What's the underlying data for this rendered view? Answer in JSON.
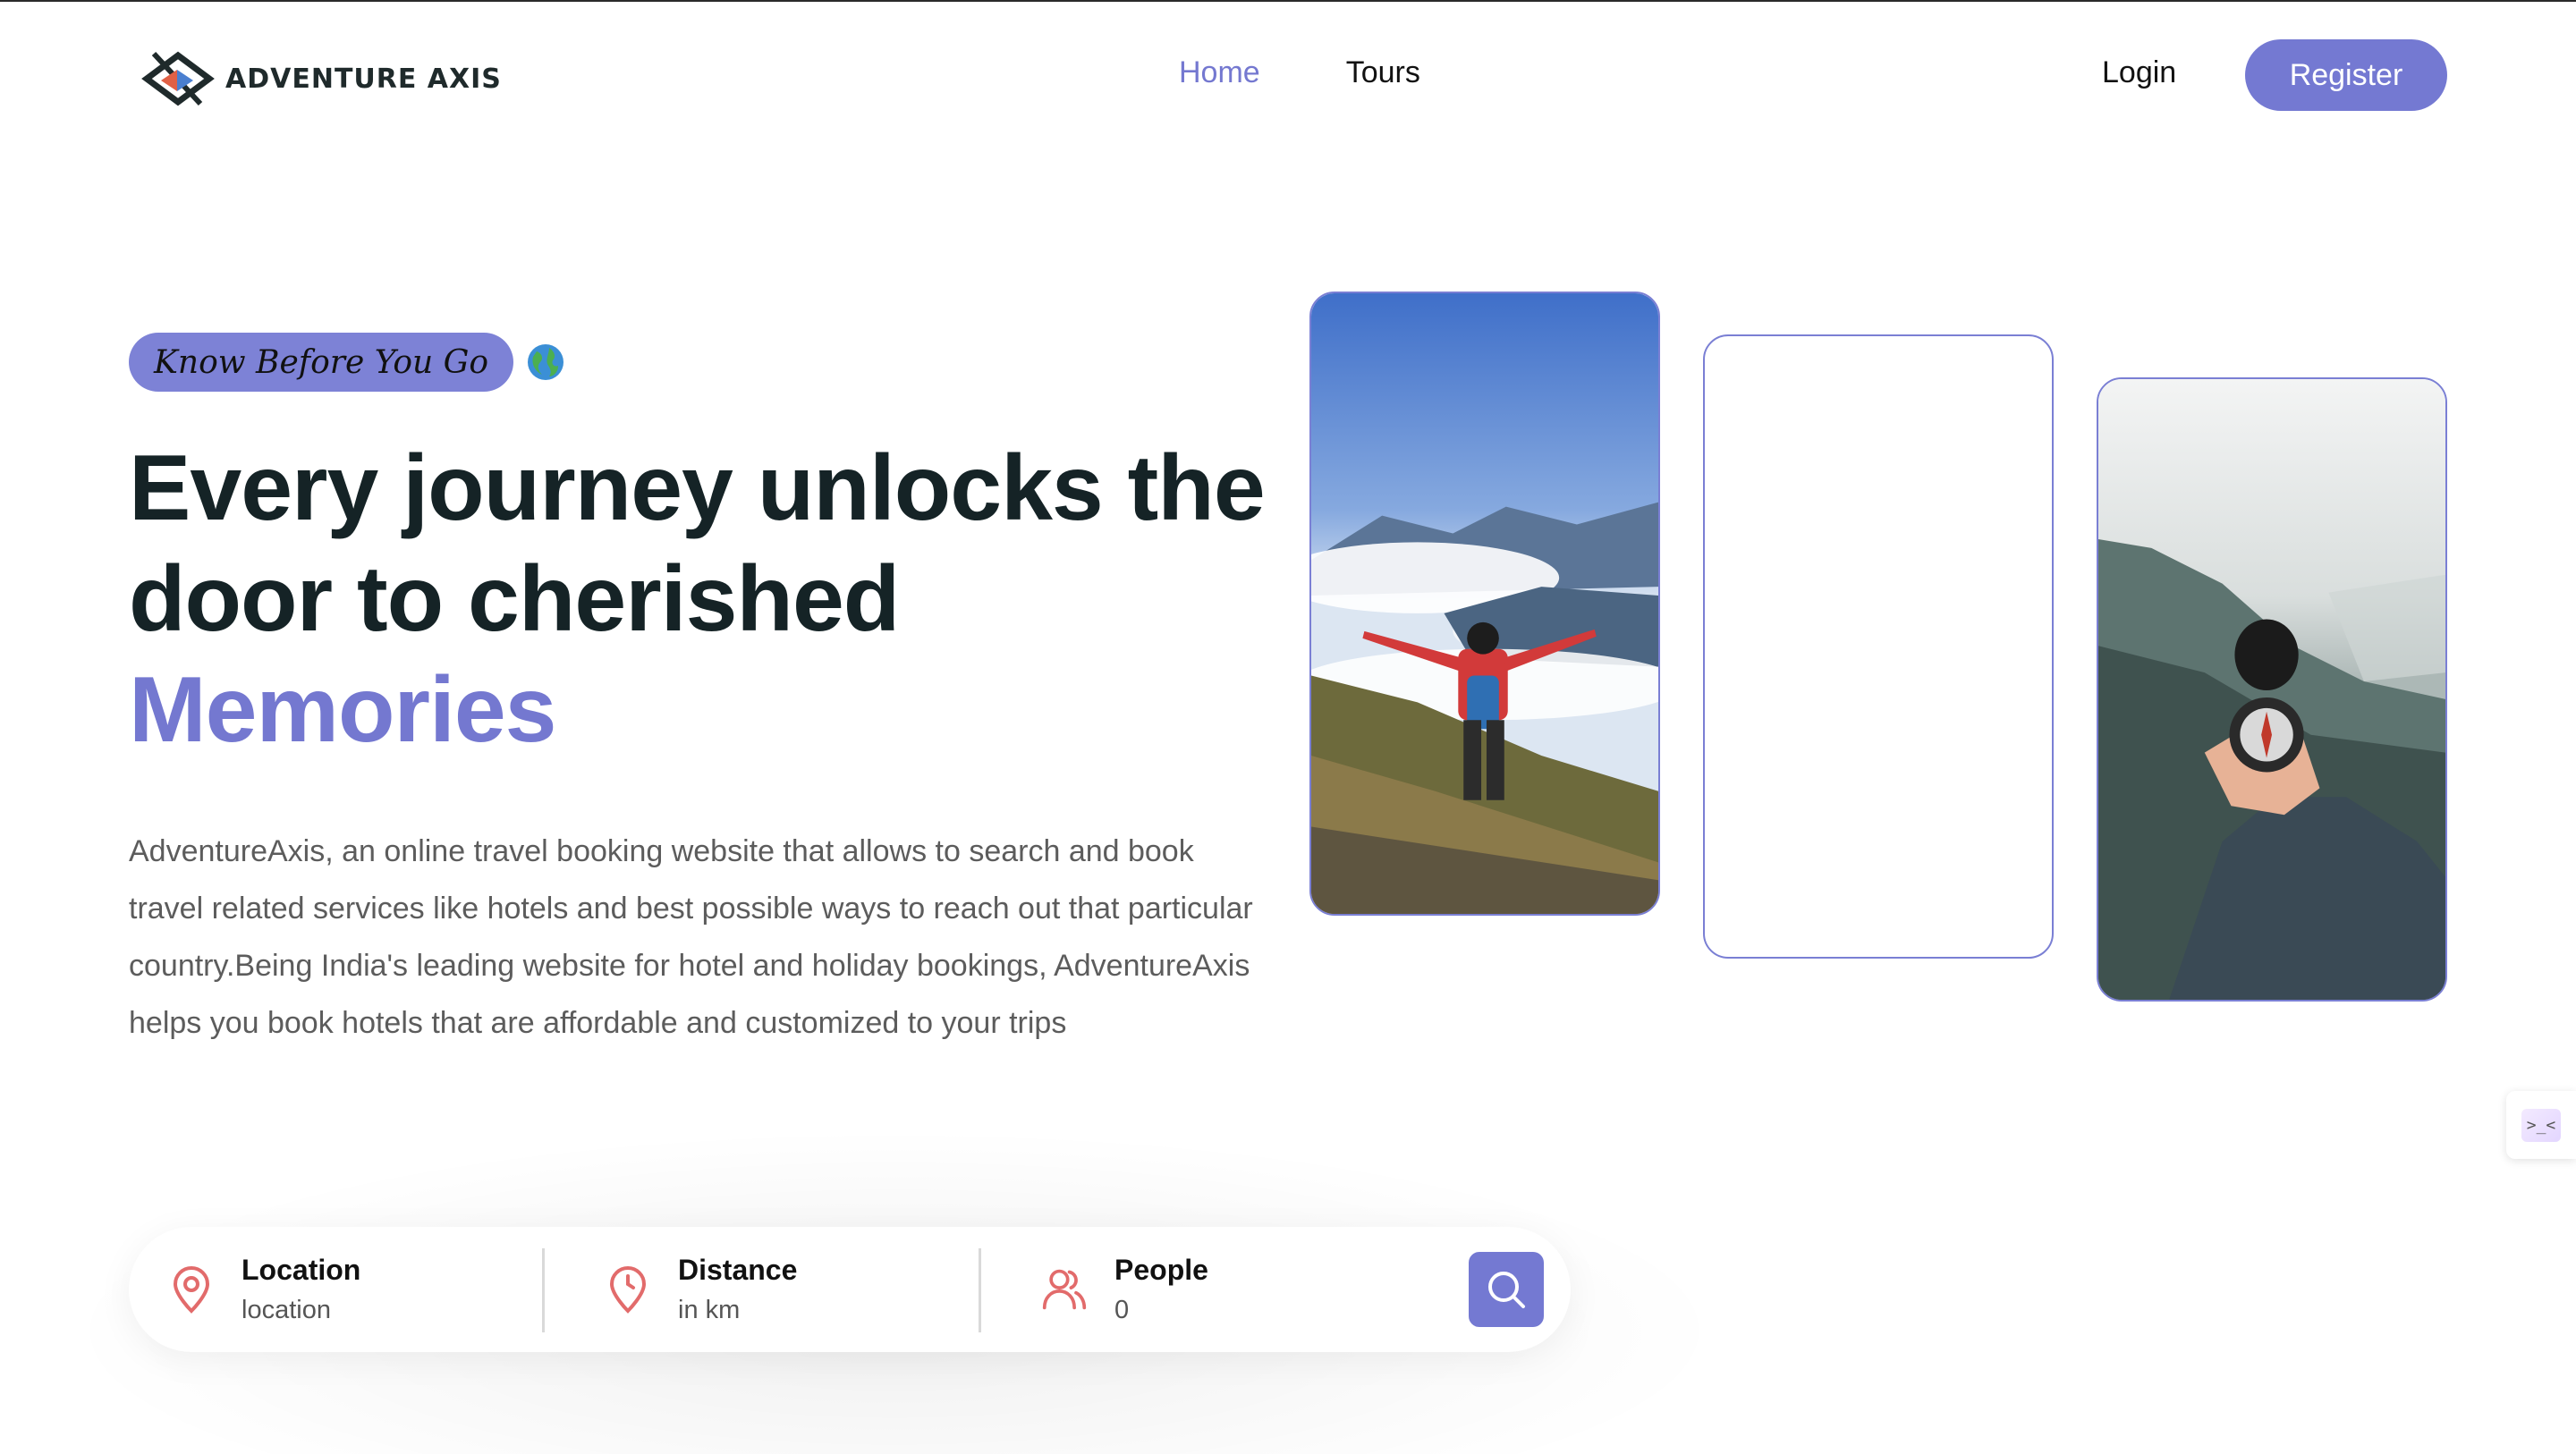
{
  "brand": {
    "name": "ADVENTURE AXIS",
    "logo_icon": "compass-diamond-logo"
  },
  "nav": {
    "items": [
      {
        "label": "Home",
        "active": true
      },
      {
        "label": "Tours",
        "active": false
      }
    ]
  },
  "auth": {
    "login_label": "Login",
    "register_label": "Register"
  },
  "hero": {
    "tag": "Know Before You Go",
    "tag_icon": "globe-icon",
    "headline_line1": "Every journey unlocks the",
    "headline_line2": "door to cherished",
    "headline_accent": "Memories",
    "description": "AdventureAxis, an online travel booking website that allows to search and book travel related services like hotels and best possible ways to reach out that particular country.Being India's leading website for hotel and holiday bookings, AdventureAxis helps you book hotels that are affordable and customized to your trips"
  },
  "search": {
    "location": {
      "label": "Location",
      "placeholder": "location",
      "icon": "map-pin-icon"
    },
    "distance": {
      "label": "Distance",
      "placeholder": "in km",
      "icon": "clock-pin-icon"
    },
    "people": {
      "label": "People",
      "value": "0",
      "icon": "users-icon"
    },
    "button_icon": "search-icon"
  },
  "colors": {
    "accent": "#7479d2",
    "heading": "#152326",
    "icon_red": "#e26b6b"
  }
}
